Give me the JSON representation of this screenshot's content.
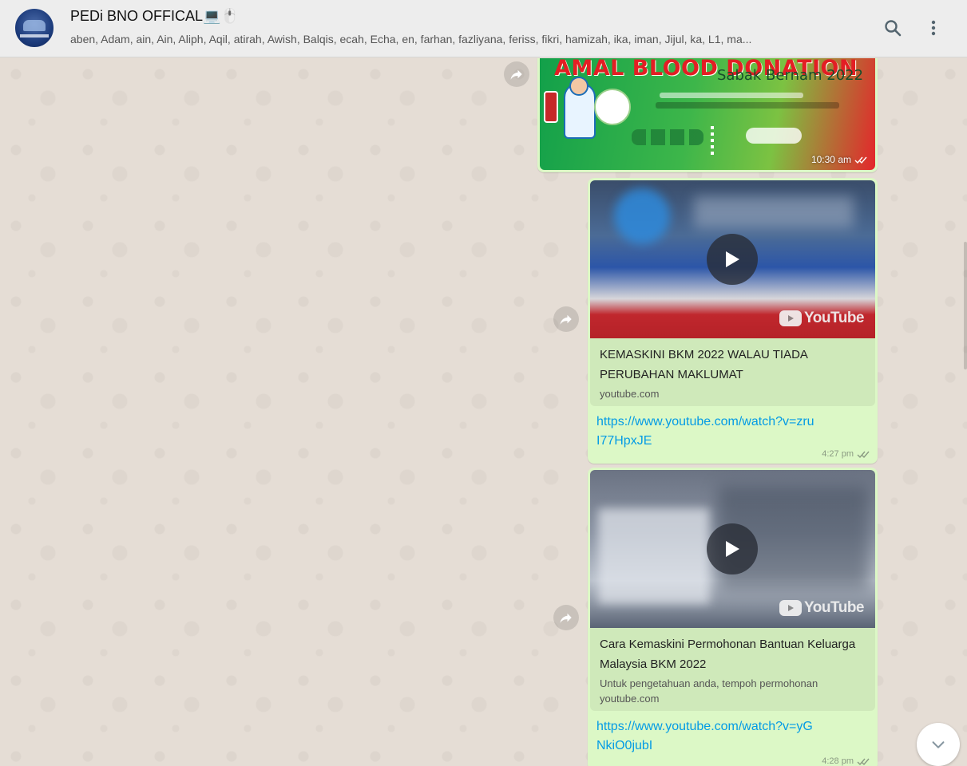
{
  "header": {
    "group_name": "PEDi BNO OFFICAL💻🖱️",
    "members": "aben, Adam, ain, Ain, Aliph, Aqil, atirah, Awish, Balqis, ecah, Echa, en, farhan, fazliyana, feriss, fikri, hamizah, ika, iman, Jijul, ka, L1, ma..."
  },
  "messages": {
    "image": {
      "banner_title": "AMAL BLOOD DONATION",
      "banner_subtitle": "Sabak Bernam 2022",
      "time": "10:30 am"
    },
    "link1": {
      "title": "KEMASKINI BKM 2022 WALAU TIADA PERUBAHAN MAKLUMAT",
      "domain": "youtube.com",
      "url": "https://www.youtube.com/watch?v=zruI77HpxJE",
      "time": "4:27 pm",
      "youtube_label": "YouTube"
    },
    "link2": {
      "title": "Cara Kemaskini Permohonan Bantuan Keluarga Malaysia BKM 2022",
      "description": "Untuk pengetahuan anda, tempoh permohonan",
      "domain": "youtube.com",
      "url": "https://www.youtube.com/watch?v=yGNkiO0jubI",
      "time": "4:28 pm",
      "youtube_label": "YouTube"
    }
  },
  "icons": {
    "search": "search-icon",
    "menu": "more-vertical-icon",
    "forward": "forward-icon",
    "play": "play-icon",
    "read_receipt": "double-check-icon",
    "scroll_down": "chevron-down-icon"
  },
  "colors": {
    "bubble_outgoing": "#dcf8c6",
    "link_preview_bg": "#cfe9ba",
    "link": "#039be5",
    "header_bg": "#ededed",
    "chat_bg": "#e5ddd5"
  }
}
